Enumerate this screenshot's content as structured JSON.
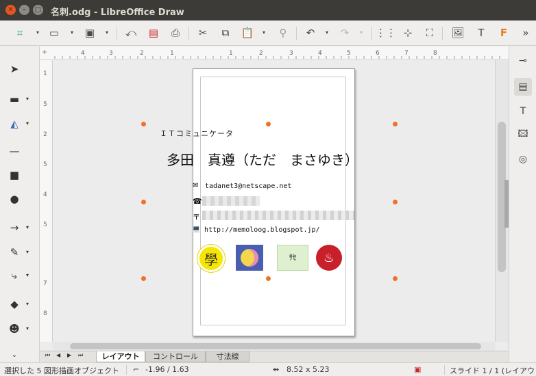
{
  "window": {
    "title": "名刺.odg - LibreOffice Draw"
  },
  "ruler": {
    "h_labels": [
      "4",
      "3",
      "2",
      "1",
      "1",
      "2",
      "3",
      "4",
      "5",
      "6",
      "7",
      "8"
    ],
    "v_labels": [
      "1",
      "5",
      "2",
      "5",
      "4",
      "5",
      "7",
      "8"
    ]
  },
  "card": {
    "tagline": "ＩＴコミュニケータ",
    "name": "多田　真遵（ただ　まさゆき）",
    "email": "tadanet3@netscape.net",
    "url": "http://memoloog.blogspot.jp/",
    "email_icon": "✉",
    "phone_icon": "☎",
    "postal_icon": "〒",
    "pc_icon": "💻",
    "logo1_text": "學"
  },
  "tabs": [
    "レイアウト",
    "コントロール",
    "寸法線"
  ],
  "status": {
    "selection": "選択した 5 図形描画オブジェクト",
    "position": "-1.96 / 1.63",
    "size": "8.52 x 5.23",
    "slide": "スライド 1 / 1 (レイアウト)"
  },
  "colors": {
    "handle": "#f0702c",
    "titlebar": "#3c3b37",
    "close": "#e95420"
  }
}
